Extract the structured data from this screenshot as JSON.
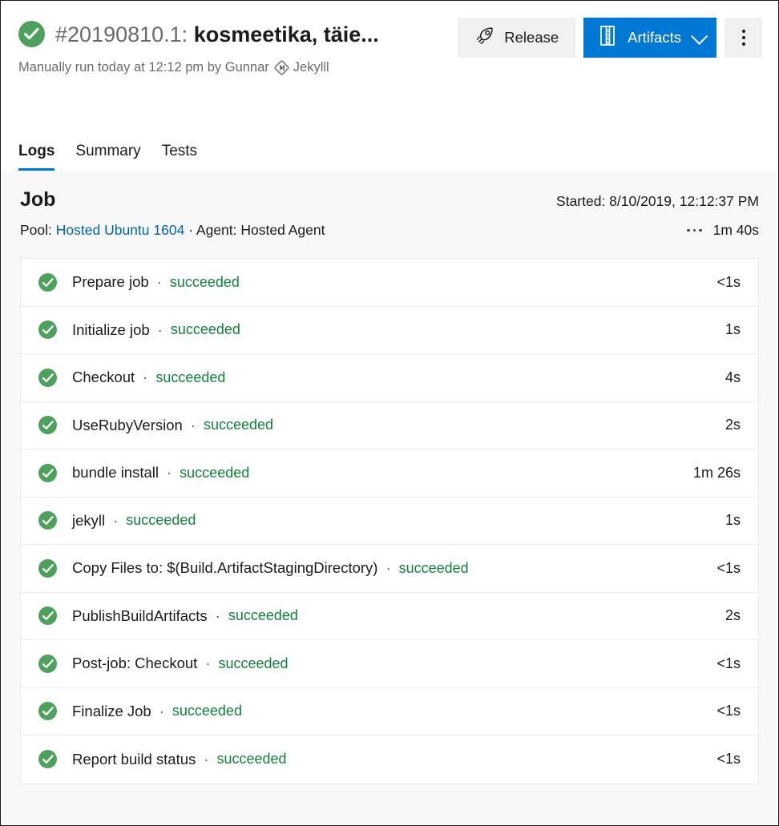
{
  "header": {
    "status_icon": "check-circle-icon",
    "status_color": "#4ea15c",
    "build_number": "#20190810.1:",
    "build_name": "kosmeetika, täie...",
    "subtitle_prefix": "Manually run today at 12:12 pm by Gunnar",
    "repo_icon": "git-repo-icon",
    "repo_name": "Jekylll",
    "actions": {
      "release_label": "Release",
      "release_icon": "rocket-icon",
      "artifacts_label": "Artifacts",
      "artifacts_icon": "zip-file-icon",
      "artifacts_chevron_icon": "chevron-down-icon",
      "more_icon": "more-vertical-icon",
      "primary_color": "#0078d4"
    }
  },
  "tabs": [
    {
      "label": "Logs",
      "active": true
    },
    {
      "label": "Summary",
      "active": false
    },
    {
      "label": "Tests",
      "active": false
    }
  ],
  "job": {
    "title": "Job",
    "started_label": "Started: 8/10/2019, 12:12:37 PM",
    "pool_prefix": "Pool:",
    "pool_link": "Hosted Ubuntu 1604",
    "separator": "·",
    "agent_label": "Agent: Hosted Agent",
    "more_icon": "more-horizontal-icon",
    "duration": "1m 40s"
  },
  "tasks": [
    {
      "icon": "check-circle-icon",
      "name": "Prepare job",
      "sep": "·",
      "status": "succeeded",
      "duration": "<1s"
    },
    {
      "icon": "check-circle-icon",
      "name": "Initialize job",
      "sep": "·",
      "status": "succeeded",
      "duration": "1s"
    },
    {
      "icon": "check-circle-icon",
      "name": "Checkout",
      "sep": "·",
      "status": "succeeded",
      "duration": "4s"
    },
    {
      "icon": "check-circle-icon",
      "name": "UseRubyVersion",
      "sep": "·",
      "status": "succeeded",
      "duration": "2s"
    },
    {
      "icon": "check-circle-icon",
      "name": "bundle install",
      "sep": "·",
      "status": "succeeded",
      "duration": "1m 26s"
    },
    {
      "icon": "check-circle-icon",
      "name": "jekyll",
      "sep": "·",
      "status": "succeeded",
      "duration": "1s"
    },
    {
      "icon": "check-circle-icon",
      "name": "Copy Files to: $(Build.ArtifactStagingDirectory)",
      "sep": "·",
      "status": "succeeded",
      "duration": "<1s"
    },
    {
      "icon": "check-circle-icon",
      "name": "PublishBuildArtifacts",
      "sep": "·",
      "status": "succeeded",
      "duration": "2s"
    },
    {
      "icon": "check-circle-icon",
      "name": "Post-job: Checkout",
      "sep": "·",
      "status": "succeeded",
      "duration": "<1s"
    },
    {
      "icon": "check-circle-icon",
      "name": "Finalize Job",
      "sep": "·",
      "status": "succeeded",
      "duration": "<1s"
    },
    {
      "icon": "check-circle-icon",
      "name": "Report build status",
      "sep": "·",
      "status": "succeeded",
      "duration": "<1s"
    }
  ],
  "colors": {
    "success_green": "#4ea15c",
    "status_text_green": "#11823b",
    "accent_blue": "#0078d4",
    "link_blue": "#0063b1"
  }
}
